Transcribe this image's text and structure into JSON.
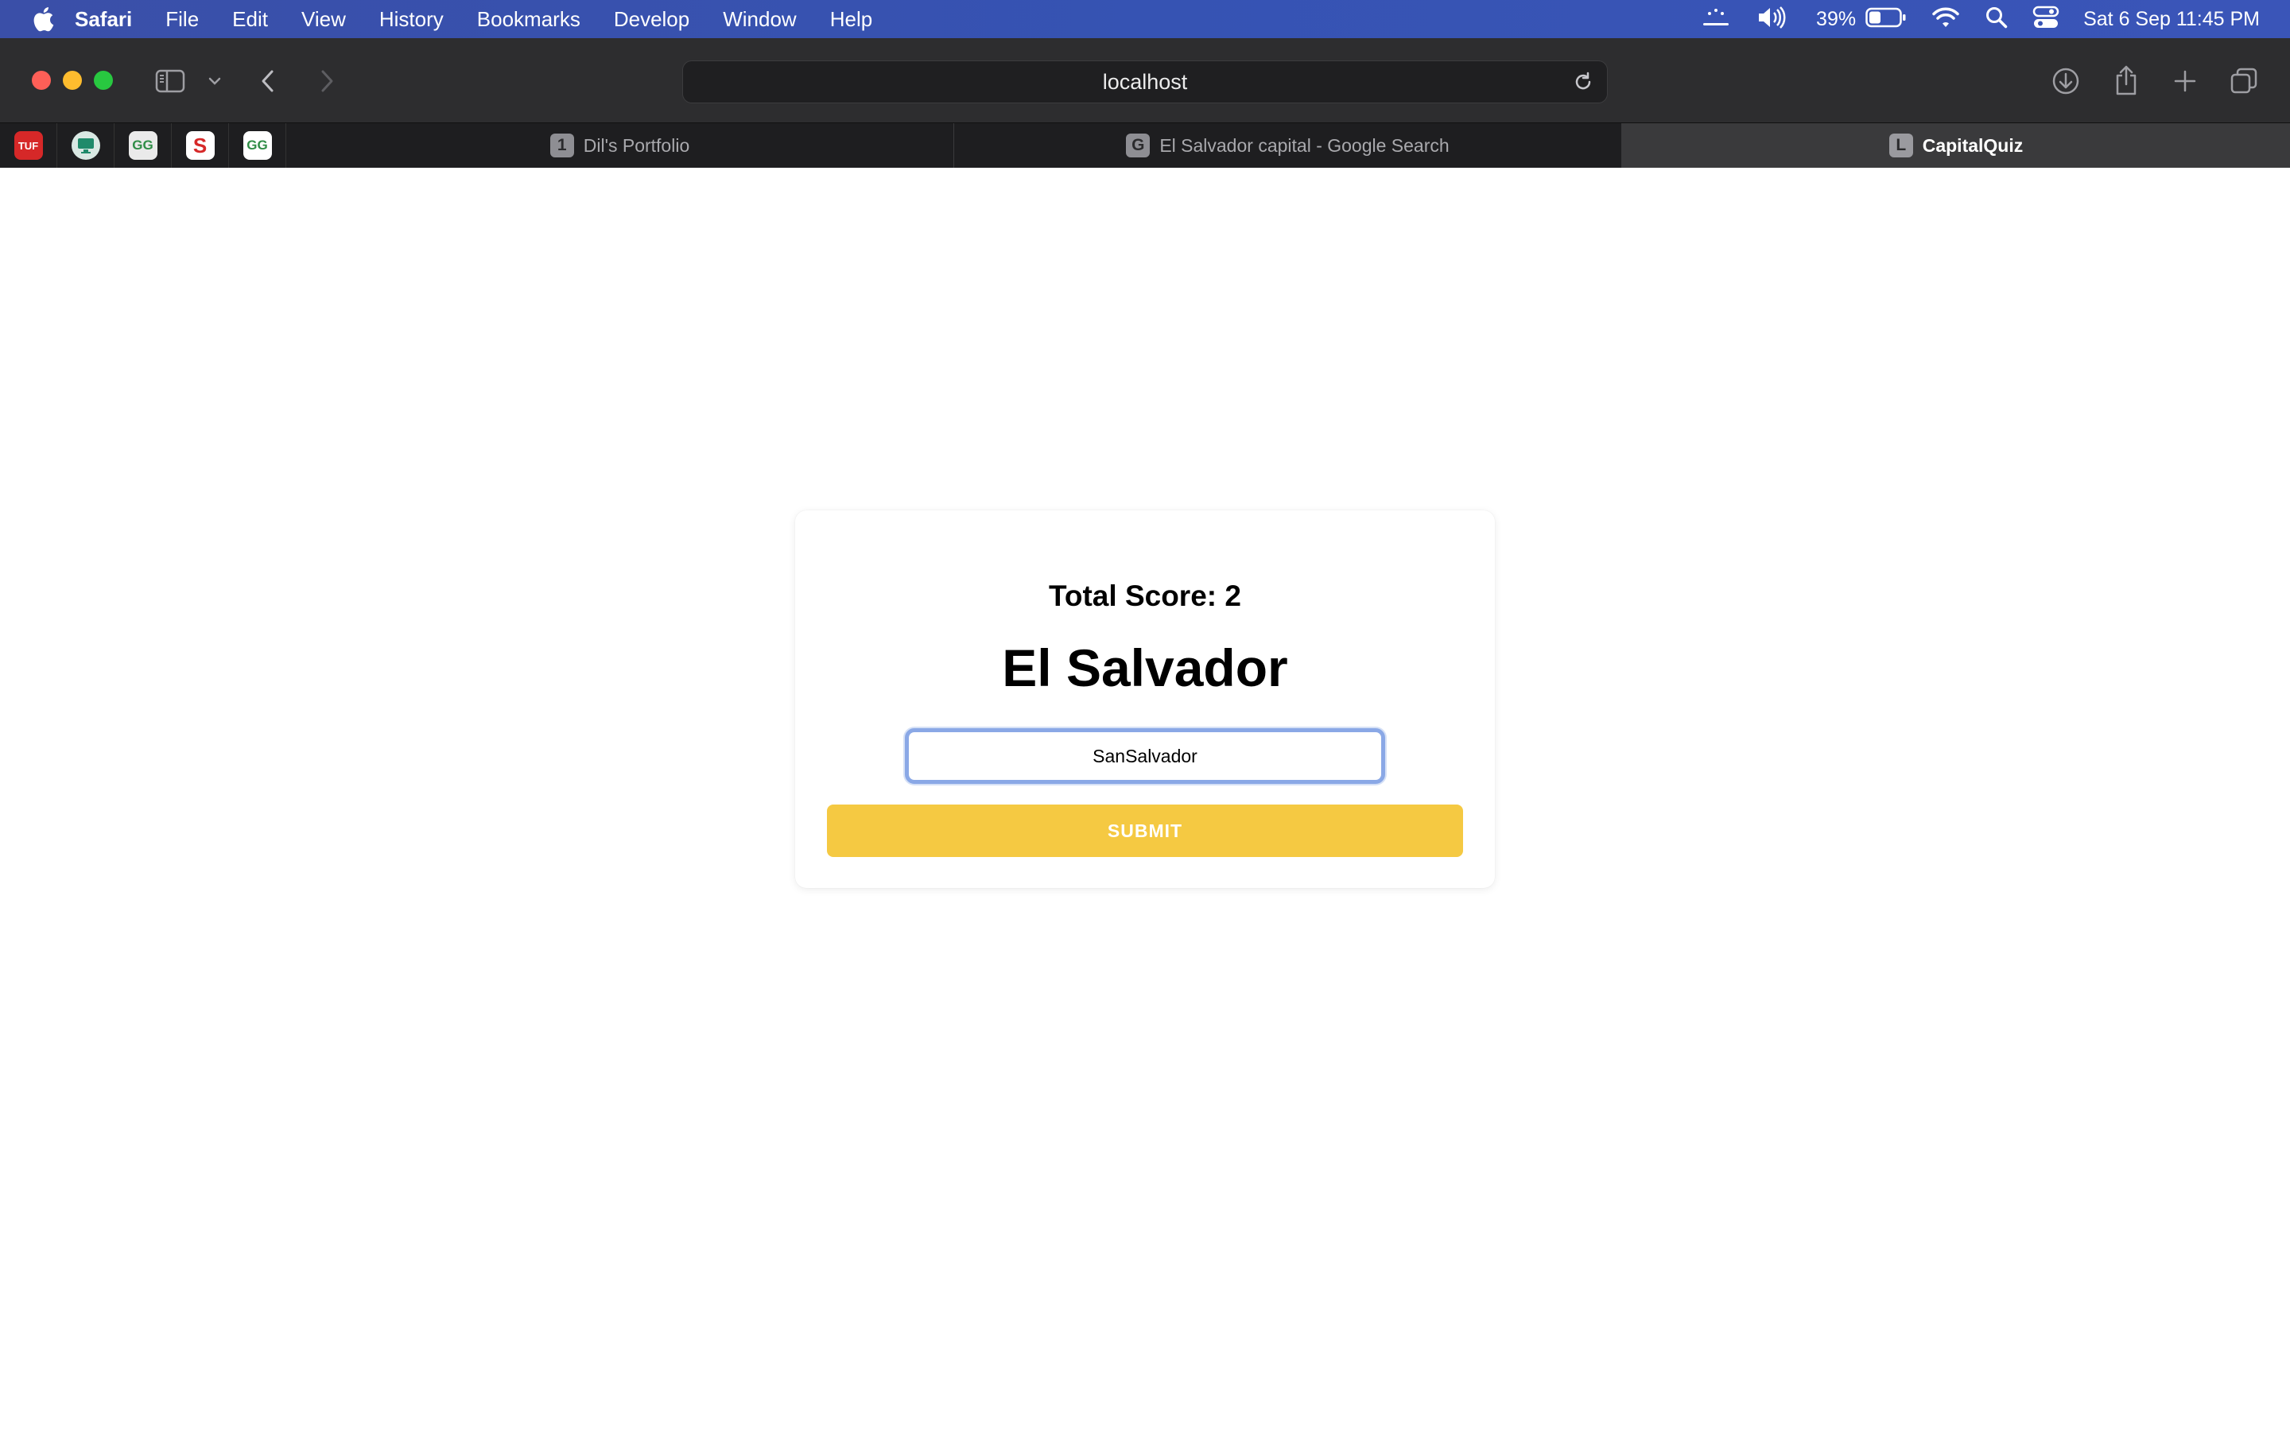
{
  "menubar": {
    "app_name": "Safari",
    "items": [
      "File",
      "Edit",
      "View",
      "History",
      "Bookmarks",
      "Develop",
      "Window",
      "Help"
    ],
    "battery_percent": "39%",
    "battery_level": 0.39,
    "datetime": "Sat 6 Sep  11:45 PM"
  },
  "browser": {
    "address": "localhost",
    "pinned_tabs": [
      {
        "icon": "tuf-icon",
        "text": "TUF",
        "color": "#d62828"
      },
      {
        "icon": "monitor-icon",
        "text": "",
        "color": "#1f8a6a"
      },
      {
        "icon": "geeksforgeeks-icon",
        "text": "GG",
        "color": "#2f8d46"
      },
      {
        "icon": "s-icon",
        "text": "S",
        "color": "#d62828"
      },
      {
        "icon": "geeksforgeeks-icon",
        "text": "GG",
        "color": "#2f8d46"
      }
    ],
    "tabs": [
      {
        "favicon": "1",
        "title": "Dil's Portfolio"
      },
      {
        "favicon": "G",
        "title": "El Salvador  capital - Google Search"
      },
      {
        "favicon": "L",
        "title": "CapitalQuiz"
      }
    ]
  },
  "quiz": {
    "score_text": "Total Score: 2",
    "country": "El Salvador",
    "answer_value": "SanSalvador",
    "submit_label": "SUBMIT",
    "accent_color": "#f5c942"
  }
}
